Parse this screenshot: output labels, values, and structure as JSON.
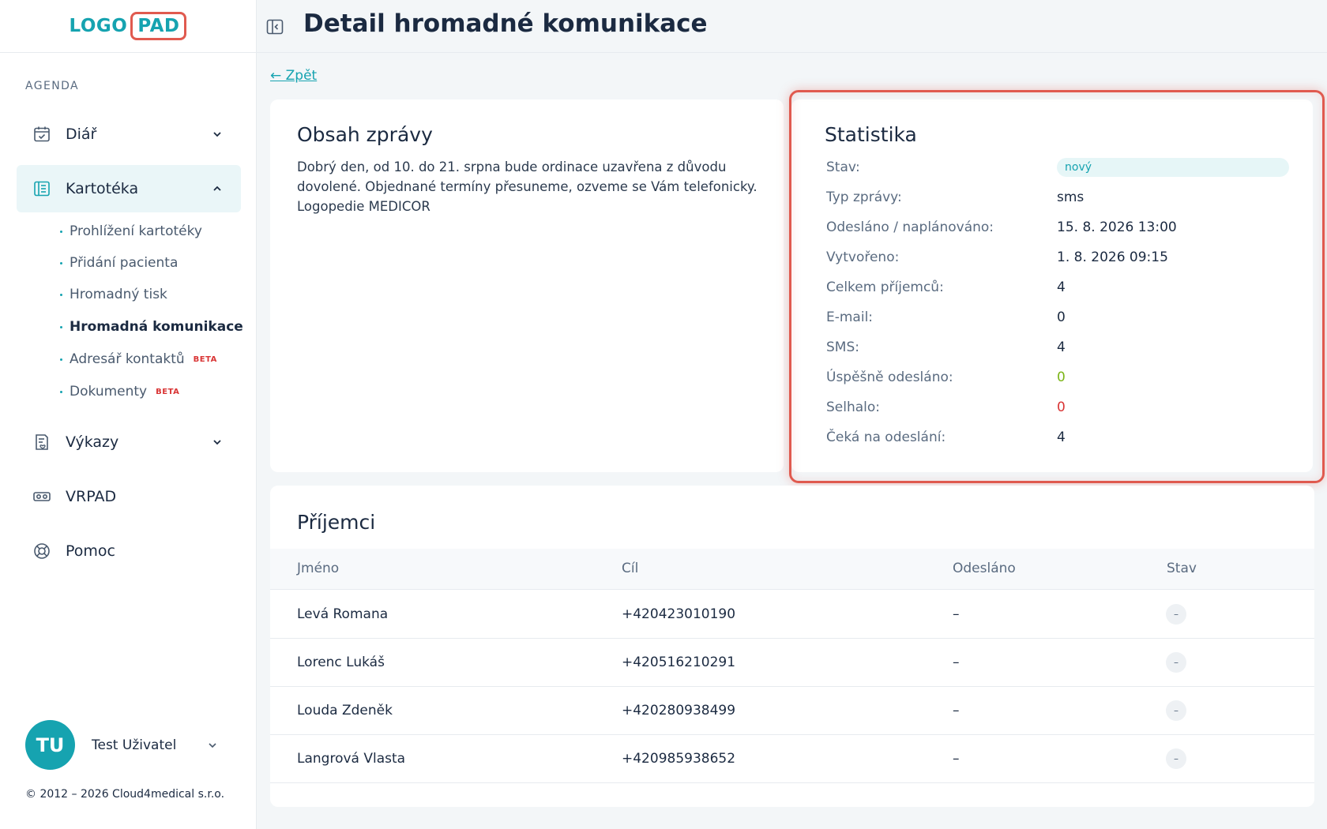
{
  "logo": {
    "word": "LOGO",
    "boxed": "PAD"
  },
  "sidebar": {
    "section_label": "AGENDA",
    "items": [
      {
        "label": "Diář",
        "icon": "calendar-check-icon"
      },
      {
        "label": "Kartotéka",
        "icon": "card-index-icon",
        "active": true
      },
      {
        "label": "Výkazy",
        "icon": "report-icon"
      },
      {
        "label": "VRPAD",
        "icon": "vr-headset-icon"
      },
      {
        "label": "Pomoc",
        "icon": "lifebuoy-icon"
      }
    ],
    "subitems": [
      {
        "label": "Prohlížení kartotéky"
      },
      {
        "label": "Přidání pacienta"
      },
      {
        "label": "Hromadný tisk"
      },
      {
        "label": "Hromadná komunikace",
        "current": true
      },
      {
        "label": "Adresář kontaktů",
        "badge": "BETA"
      },
      {
        "label": "Dokumenty",
        "badge": "BETA"
      }
    ],
    "user": {
      "initials": "TU",
      "name": "Test Uživatel"
    },
    "copyright": "© 2012 – 2026 Cloud4medical s.r.o."
  },
  "header": {
    "title": "Detail hromadné komunikace"
  },
  "back_link": "← Zpět",
  "message": {
    "title": "Obsah zprávy",
    "body": "Dobrý den, od 10. do 21. srpna bude ordinace uzavřena z důvodu dovolené. Objednané termíny přesuneme, ozveme se Vám telefonicky. Logopedie MEDICOR"
  },
  "stats": {
    "title": "Statistika",
    "rows": [
      {
        "label": "Stav:",
        "value": "nový"
      },
      {
        "label": "Typ zprávy:",
        "value": "sms"
      },
      {
        "label": "Odesláno / naplánováno:",
        "value": "15. 8. 2026 13:00"
      },
      {
        "label": "Vytvořeno:",
        "value": "1. 8. 2026 09:15"
      },
      {
        "label": "Celkem příjemců:",
        "value": "4"
      },
      {
        "label": "E-mail:",
        "value": "0"
      },
      {
        "label": "SMS:",
        "value": "4"
      },
      {
        "label": "Úspěšně odesláno:",
        "value": "0"
      },
      {
        "label": "Selhalo:",
        "value": "0"
      },
      {
        "label": "Čeká na odeslání:",
        "value": "4"
      }
    ],
    "colors": {
      "success": "#7cb518",
      "failed": "#d93535",
      "accent": "#16a3b0",
      "highlight": "#e05a4f"
    }
  },
  "recipients": {
    "title": "Příjemci",
    "columns": [
      "Jméno",
      "Cíl",
      "Odesláno",
      "Stav"
    ],
    "rows": [
      {
        "name": "Levá Romana",
        "target": "+420423010190",
        "sent": "–",
        "status": "–"
      },
      {
        "name": "Lorenc Lukáš",
        "target": "+420516210291",
        "sent": "–",
        "status": "–"
      },
      {
        "name": "Louda Zdeněk",
        "target": "+420280938499",
        "sent": "–",
        "status": "–"
      },
      {
        "name": "Langrová Vlasta",
        "target": "+420985938652",
        "sent": "–",
        "status": "–"
      }
    ]
  }
}
